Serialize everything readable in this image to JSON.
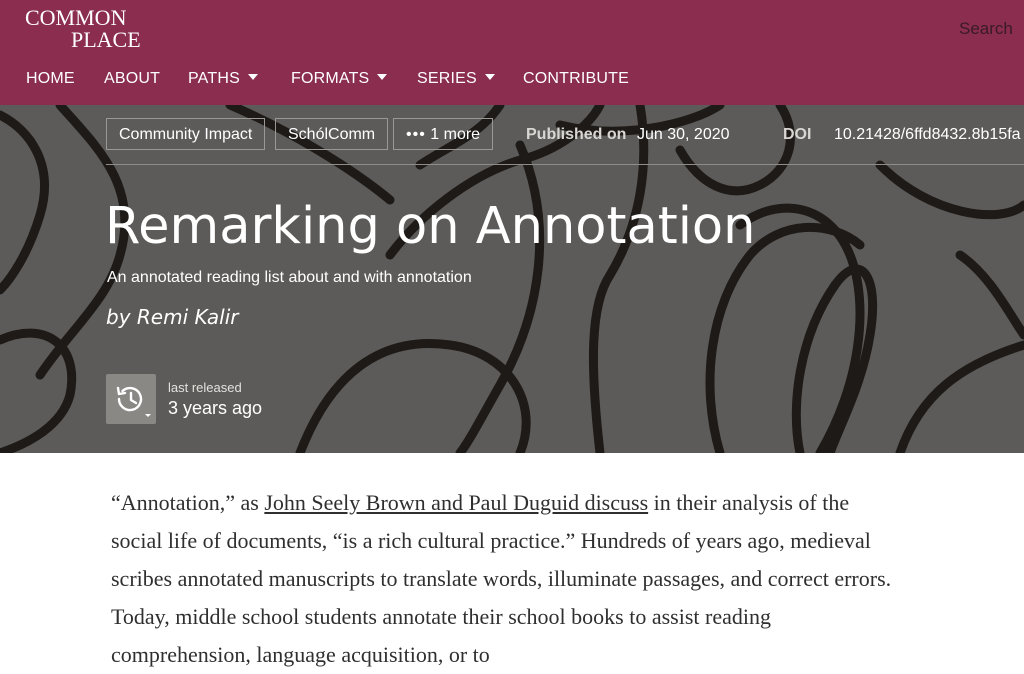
{
  "logo": {
    "line1": "COMMON",
    "line2": "PLACE"
  },
  "search": {
    "label": "Search"
  },
  "nav": {
    "home": "HOME",
    "about": "ABOUT",
    "paths": "PATHS",
    "formats": "FORMATS",
    "series": "SERIES",
    "contribute": "CONTRIBUTE"
  },
  "tags": [
    "Community Impact",
    "SchólComm",
    "1 more"
  ],
  "publication": {
    "published_label": "Published on",
    "published_date": "Jun 30, 2020",
    "doi_label": "DOI",
    "doi_value": "10.21428/6ffd8432.8b15fa"
  },
  "article": {
    "title": "Remarking on Annotation",
    "subtitle": "An annotated reading list about and with annotation",
    "byline": "by Remi Kalir"
  },
  "release": {
    "label": "last released",
    "value": "3 years ago"
  },
  "body": {
    "p1_before": "“Annotation,” as ",
    "p1_link": "John Seely Brown and Paul Duguid discuss",
    "p1_after": " in their analysis of the social life of documents, “is a rich cultural practice.” Hundreds of years ago, medieval scribes annotated manuscripts to translate words, illuminate passages, and correct errors. Today, middle school students annotate their school books to assist reading comprehension, language acquisition, or to"
  },
  "colors": {
    "brand": "#8a2d4e",
    "hero_bg": "#5d5b59"
  }
}
